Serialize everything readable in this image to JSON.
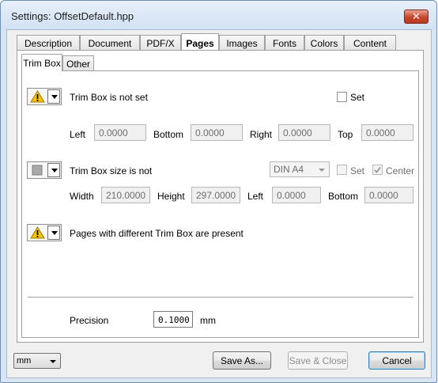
{
  "window": {
    "title": "Settings:  OffsetDefault.hpp",
    "close_symbol": "✕"
  },
  "tabs": [
    {
      "label": "Description",
      "active": false
    },
    {
      "label": "Document",
      "active": false
    },
    {
      "label": "PDF/X",
      "active": false
    },
    {
      "label": "Pages",
      "active": true
    },
    {
      "label": "Images",
      "active": false
    },
    {
      "label": "Fonts",
      "active": false
    },
    {
      "label": "Colors",
      "active": false
    },
    {
      "label": "Content",
      "active": false
    }
  ],
  "subtabs": [
    {
      "label": "Trim Box",
      "active": true
    },
    {
      "label": "Other",
      "active": false
    }
  ],
  "trim_box": {
    "status_icon": "warning-icon",
    "status_text": "Trim Box is not set",
    "set_label": "Set",
    "set_checked": false,
    "left_label": "Left",
    "left_value": "0.0000",
    "bottom_label": "Bottom",
    "bottom_value": "0.0000",
    "right_label": "Right",
    "right_value": "0.0000",
    "top_label": "Top",
    "top_value": "0.0000"
  },
  "trim_size": {
    "status_icon": "gray-square-icon",
    "status_text": "Trim Box size is not",
    "paper_size": "DIN A4",
    "set_label": "Set",
    "set_checked": false,
    "center_label": "Center",
    "center_checked": true,
    "width_label": "Width",
    "width_value": "210.0000",
    "height_label": "Height",
    "height_value": "297.0000",
    "left_label": "Left",
    "left_value": "0.0000",
    "bottom_label": "Bottom",
    "bottom_value": "0.0000"
  },
  "mixed": {
    "status_icon": "warning-icon",
    "status_text": "Pages with different Trim Box are present"
  },
  "precision": {
    "label": "Precision",
    "value": "0.1000",
    "unit": "mm"
  },
  "footer": {
    "units": "mm",
    "save_as": "Save As...",
    "save_close": "Save & Close",
    "cancel": "Cancel"
  },
  "colors": {
    "warning": "#f5c400",
    "title_bg": "#d9e5f3",
    "close": "#c6452c"
  }
}
